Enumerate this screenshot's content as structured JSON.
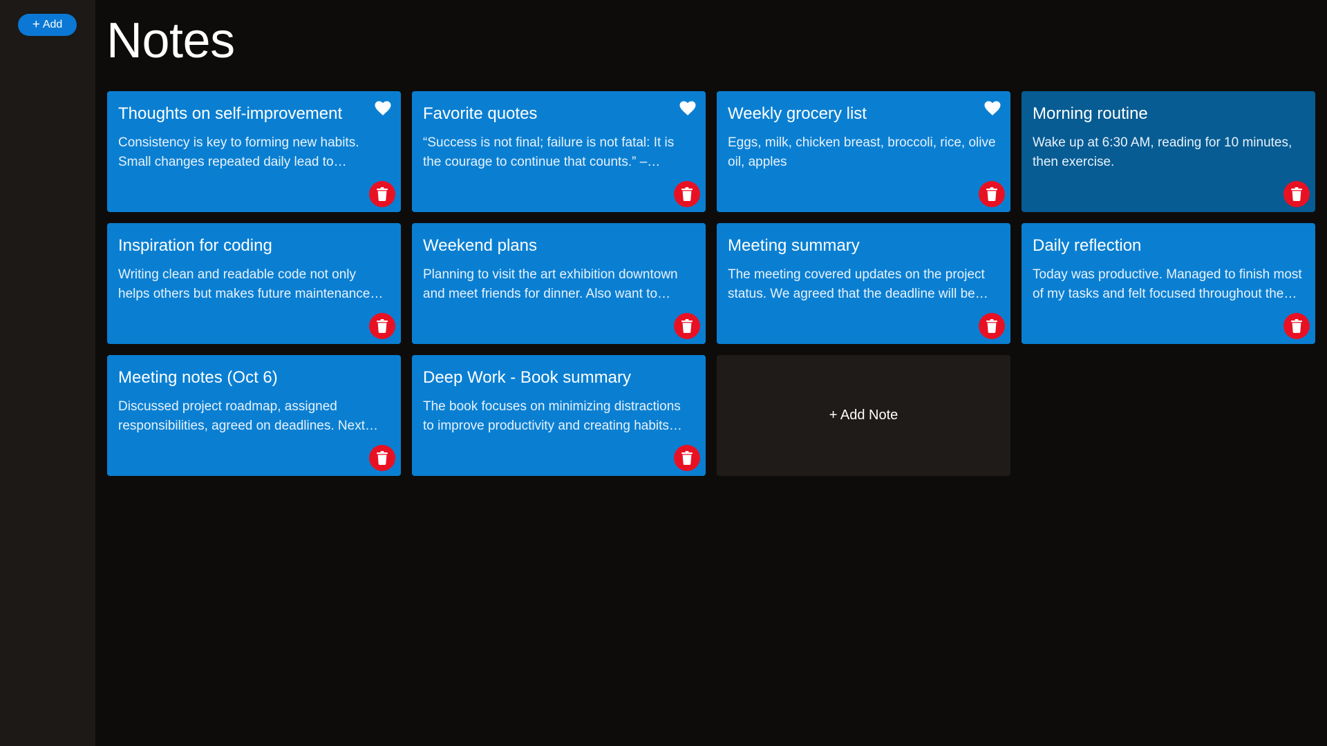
{
  "sidebar": {
    "add_button": {
      "icon": "plus-icon",
      "label": "Add"
    }
  },
  "header": {
    "title": "Notes"
  },
  "colors": {
    "card": "#0a7fd2",
    "card_selected": "#075c93",
    "delete": "#e81123",
    "background": "#0e0c0b",
    "sidebar": "#1c1917"
  },
  "notes": [
    {
      "title": "Thoughts on self-improvement",
      "body": "Consistency is key to forming new habits. Small changes repeated daily lead to significant…",
      "favorite": true,
      "selected": false
    },
    {
      "title": "Favorite quotes",
      "body": "“Success is not final; failure is not fatal: It is the courage to continue that counts.” – Winston…",
      "favorite": true,
      "selected": false
    },
    {
      "title": "Weekly grocery list",
      "body": "Eggs, milk, chicken breast, broccoli, rice, olive oil, apples",
      "favorite": true,
      "selected": false
    },
    {
      "title": "Morning routine",
      "body": "Wake up at 6:30 AM, reading for 10 minutes, then exercise.",
      "favorite": false,
      "selected": true
    },
    {
      "title": "Inspiration for coding",
      "body": "Writing clean and readable code not only helps others but makes future maintenance…",
      "favorite": false,
      "selected": false
    },
    {
      "title": "Weekend plans",
      "body": "Planning to visit the art exhibition downtown and meet friends for dinner. Also want to…",
      "favorite": false,
      "selected": false
    },
    {
      "title": "Meeting summary",
      "body": "The meeting covered updates on the project status. We agreed that the deadline will be…",
      "favorite": false,
      "selected": false
    },
    {
      "title": "Daily reflection",
      "body": "Today was productive. Managed to finish most of my tasks and felt focused throughout the…",
      "favorite": false,
      "selected": false
    },
    {
      "title": "Meeting notes (Oct 6)",
      "body": "Discussed project roadmap, assigned responsibilities, agreed on deadlines. Next…",
      "favorite": false,
      "selected": false
    },
    {
      "title": "Deep Work - Book summary",
      "body": "The book focuses on minimizing distractions to improve productivity and creating habits for…",
      "favorite": false,
      "selected": false
    }
  ],
  "add_note_card": {
    "label": "+ Add Note"
  }
}
